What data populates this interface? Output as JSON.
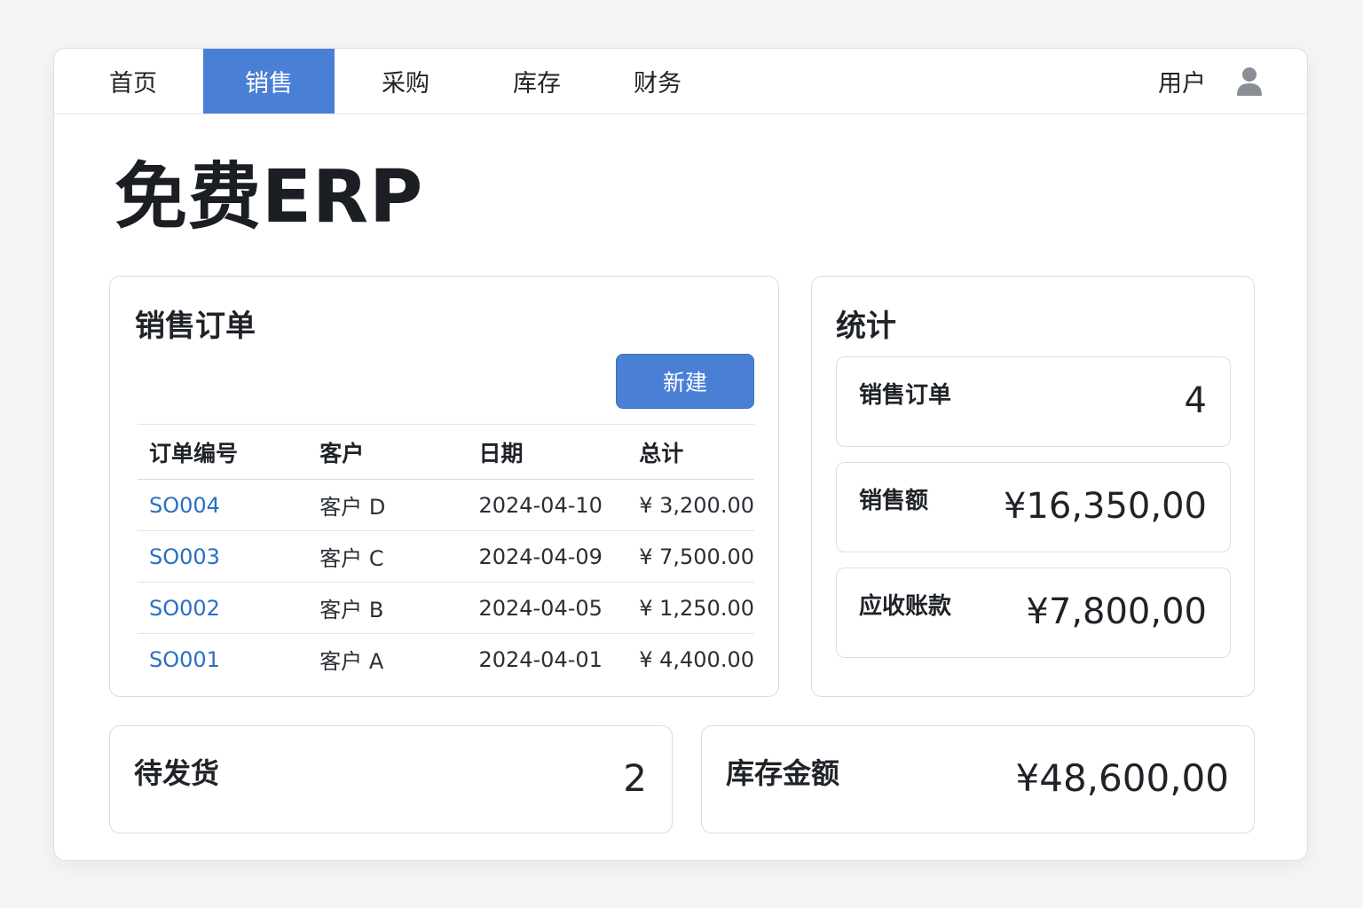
{
  "nav": {
    "items": [
      {
        "label": "首页",
        "active": false
      },
      {
        "label": "销售",
        "active": true
      },
      {
        "label": "采购",
        "active": false
      },
      {
        "label": "库存",
        "active": false
      },
      {
        "label": "财务",
        "active": false
      }
    ],
    "user_label": "用户",
    "user_icon": "user-avatar-icon",
    "accent_color": "#4a7fd6"
  },
  "page_title": "免费ERP",
  "orders": {
    "title": "销售订单",
    "new_button": "新建",
    "columns": [
      "订单编号",
      "客户",
      "日期",
      "总计"
    ],
    "rows": [
      {
        "id": "SO004",
        "customer": "客户 D",
        "date": "2024-04-10",
        "total": "¥ 3,200.00"
      },
      {
        "id": "SO003",
        "customer": "客户 C",
        "date": "2024-04-09",
        "total": "¥ 7,500.00"
      },
      {
        "id": "SO002",
        "customer": "客户 B",
        "date": "2024-04-05",
        "total": "¥ 1,250.00"
      },
      {
        "id": "SO001",
        "customer": "客户 A",
        "date": "2024-04-01",
        "total": "¥ 4,400.00"
      }
    ],
    "link_color": "#2a6fc4"
  },
  "stats": {
    "title": "统计",
    "items": [
      {
        "label": "销售订单",
        "value": "4"
      },
      {
        "label": "销售额",
        "value": "¥16,350,00"
      },
      {
        "label": "应收账款",
        "value": "¥7,800,00"
      }
    ]
  },
  "pending_shipment": {
    "label": "待发货",
    "value": "2"
  },
  "inventory_value": {
    "label": "库存金额",
    "value": "¥48,600,00"
  }
}
